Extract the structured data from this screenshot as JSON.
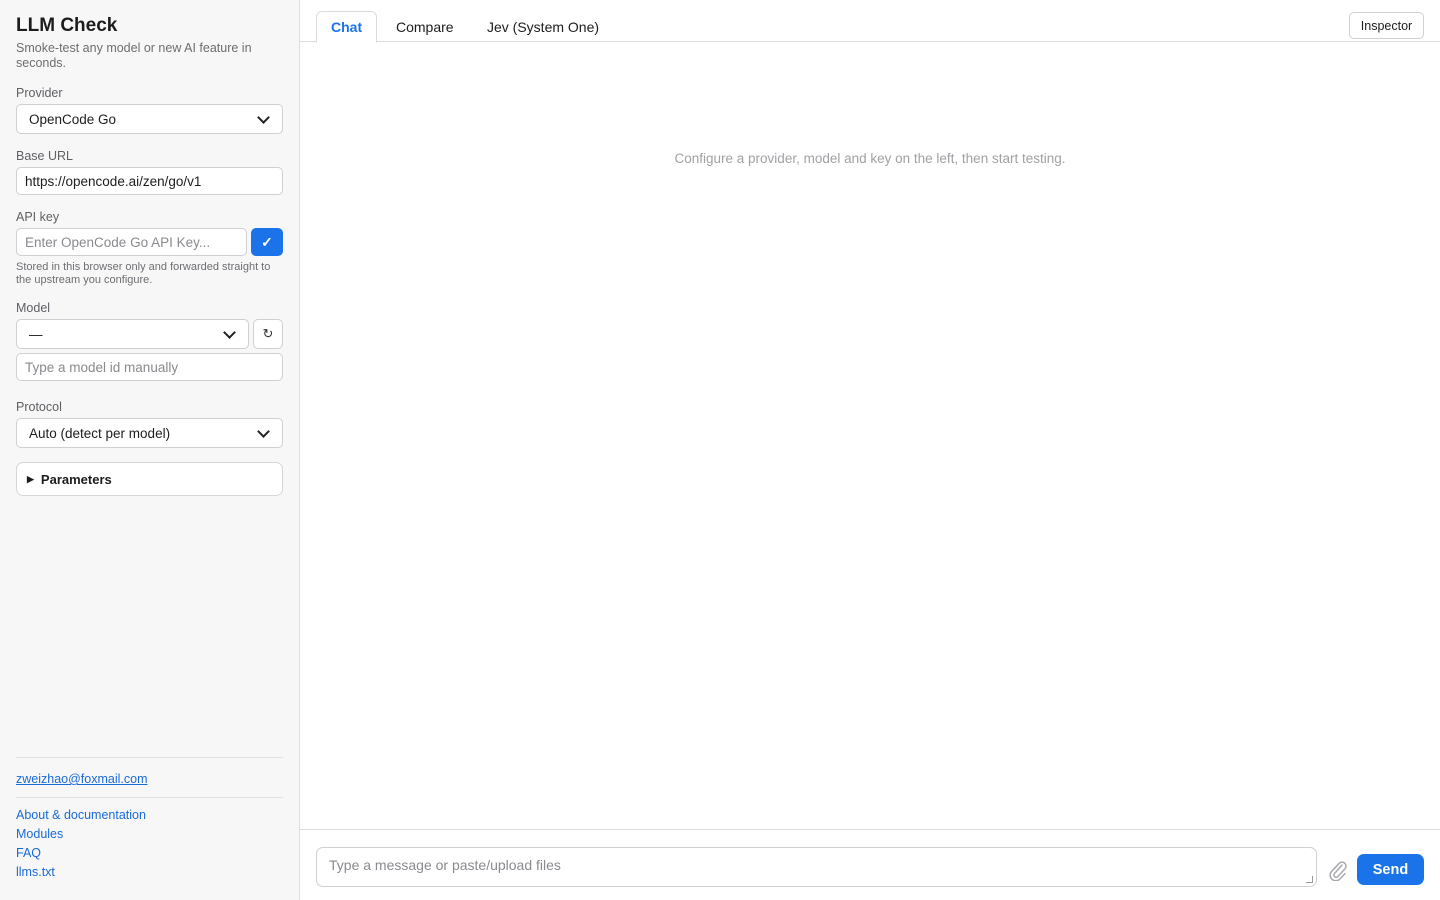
{
  "sidebar": {
    "title": "LLM Check",
    "subtitle": "Smoke-test any model or new AI feature in seconds.",
    "provider": {
      "label": "Provider",
      "value": "OpenCode Go"
    },
    "base_url": {
      "label": "Base URL",
      "value": "https://opencode.ai/zen/go/v1"
    },
    "api_key": {
      "label": "API key",
      "placeholder": "Enter OpenCode Go API Key...",
      "confirm_icon": "✓",
      "hint": "Stored in this browser only and forwarded straight to the upstream you configure."
    },
    "model": {
      "label": "Model",
      "value": "—",
      "refresh_icon": "↻",
      "manual_placeholder": "Type a model id manually"
    },
    "protocol": {
      "label": "Protocol",
      "value": "Auto (detect per model)"
    },
    "parameters": {
      "label": "Parameters"
    },
    "contact_email": "zweizhao@foxmail.com",
    "links": [
      {
        "label": "About & documentation"
      },
      {
        "label": "Modules"
      },
      {
        "label": "FAQ"
      },
      {
        "label": "llms.txt"
      }
    ]
  },
  "main": {
    "tabs": [
      {
        "label": "Chat",
        "active": true
      },
      {
        "label": "Compare",
        "active": false
      },
      {
        "label": "Jev (System One)",
        "active": false
      }
    ],
    "inspector_label": "Inspector",
    "empty_message": "Configure a provider, model and key on the left, then start testing.",
    "composer": {
      "placeholder": "Type a message or paste/upload files",
      "attach_icon": "paperclip-icon",
      "send_label": "Send"
    }
  },
  "colors": {
    "accent": "#1a73e8",
    "sidebar_bg": "#f7f7f7",
    "link": "#1a6ad6"
  }
}
